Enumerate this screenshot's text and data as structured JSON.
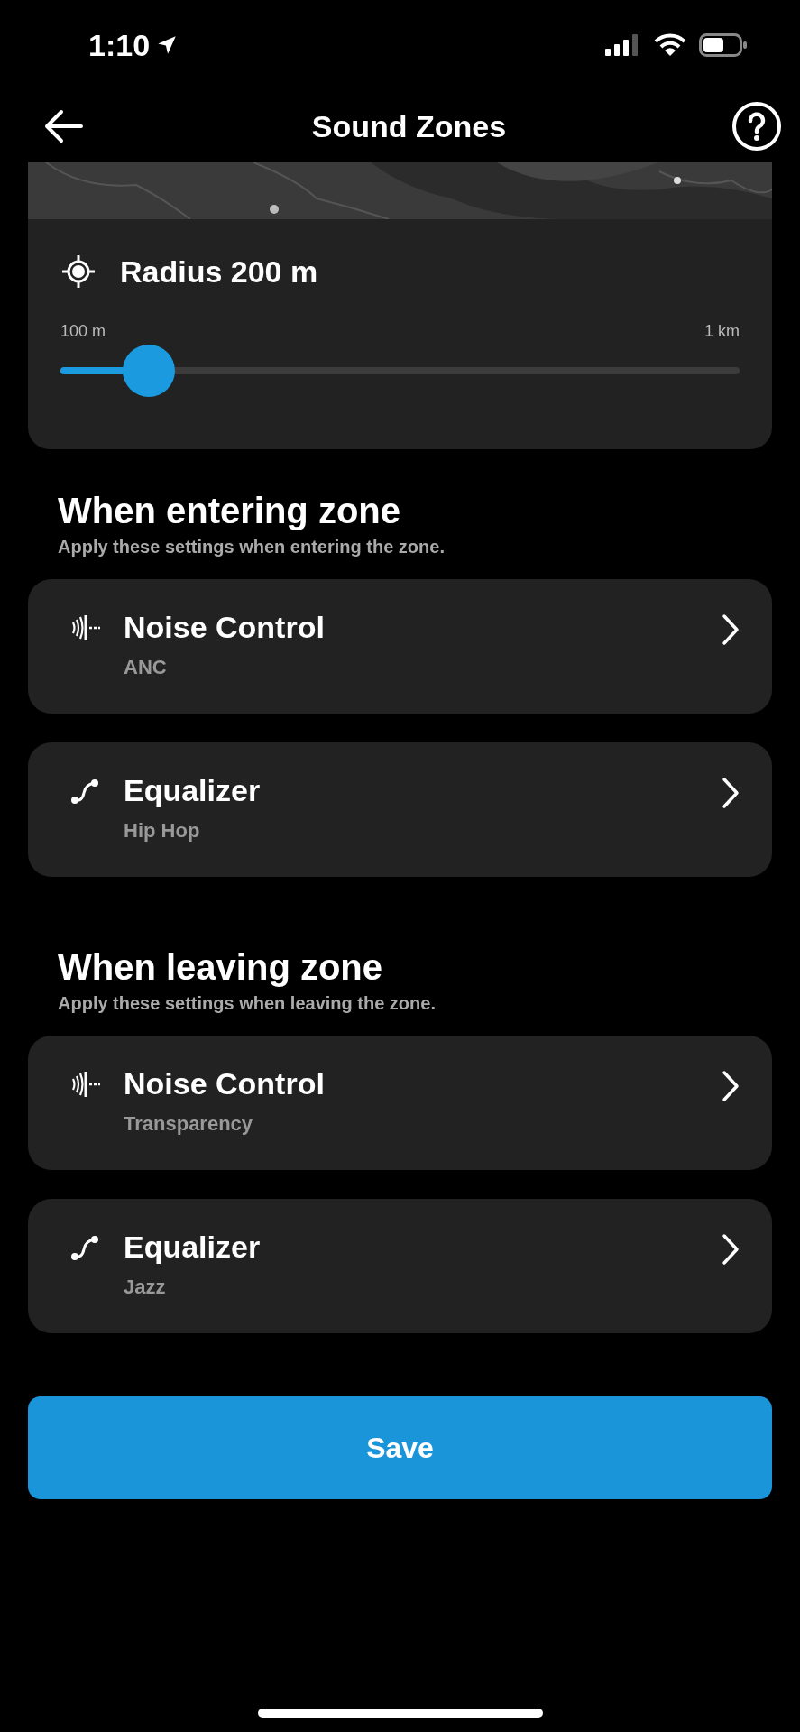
{
  "status_bar": {
    "time": "1:10"
  },
  "header": {
    "title": "Sound Zones"
  },
  "radius": {
    "title": "Radius 200 m",
    "min_label": "100 m",
    "max_label": "1 km",
    "level": 0.13
  },
  "sections": [
    {
      "title": "When entering zone",
      "subtitle": "Apply these settings when entering the zone.",
      "items": [
        {
          "kind": "noise",
          "title": "Noise Control",
          "value": "ANC"
        },
        {
          "kind": "equalizer",
          "title": "Equalizer",
          "value": "Hip Hop"
        }
      ]
    },
    {
      "title": "When leaving zone",
      "subtitle": "Apply these settings when leaving the zone.",
      "items": [
        {
          "kind": "noise",
          "title": "Noise Control",
          "value": "Transparency"
        },
        {
          "kind": "equalizer",
          "title": "Equalizer",
          "value": "Jazz"
        }
      ]
    }
  ],
  "save_button": "Save"
}
